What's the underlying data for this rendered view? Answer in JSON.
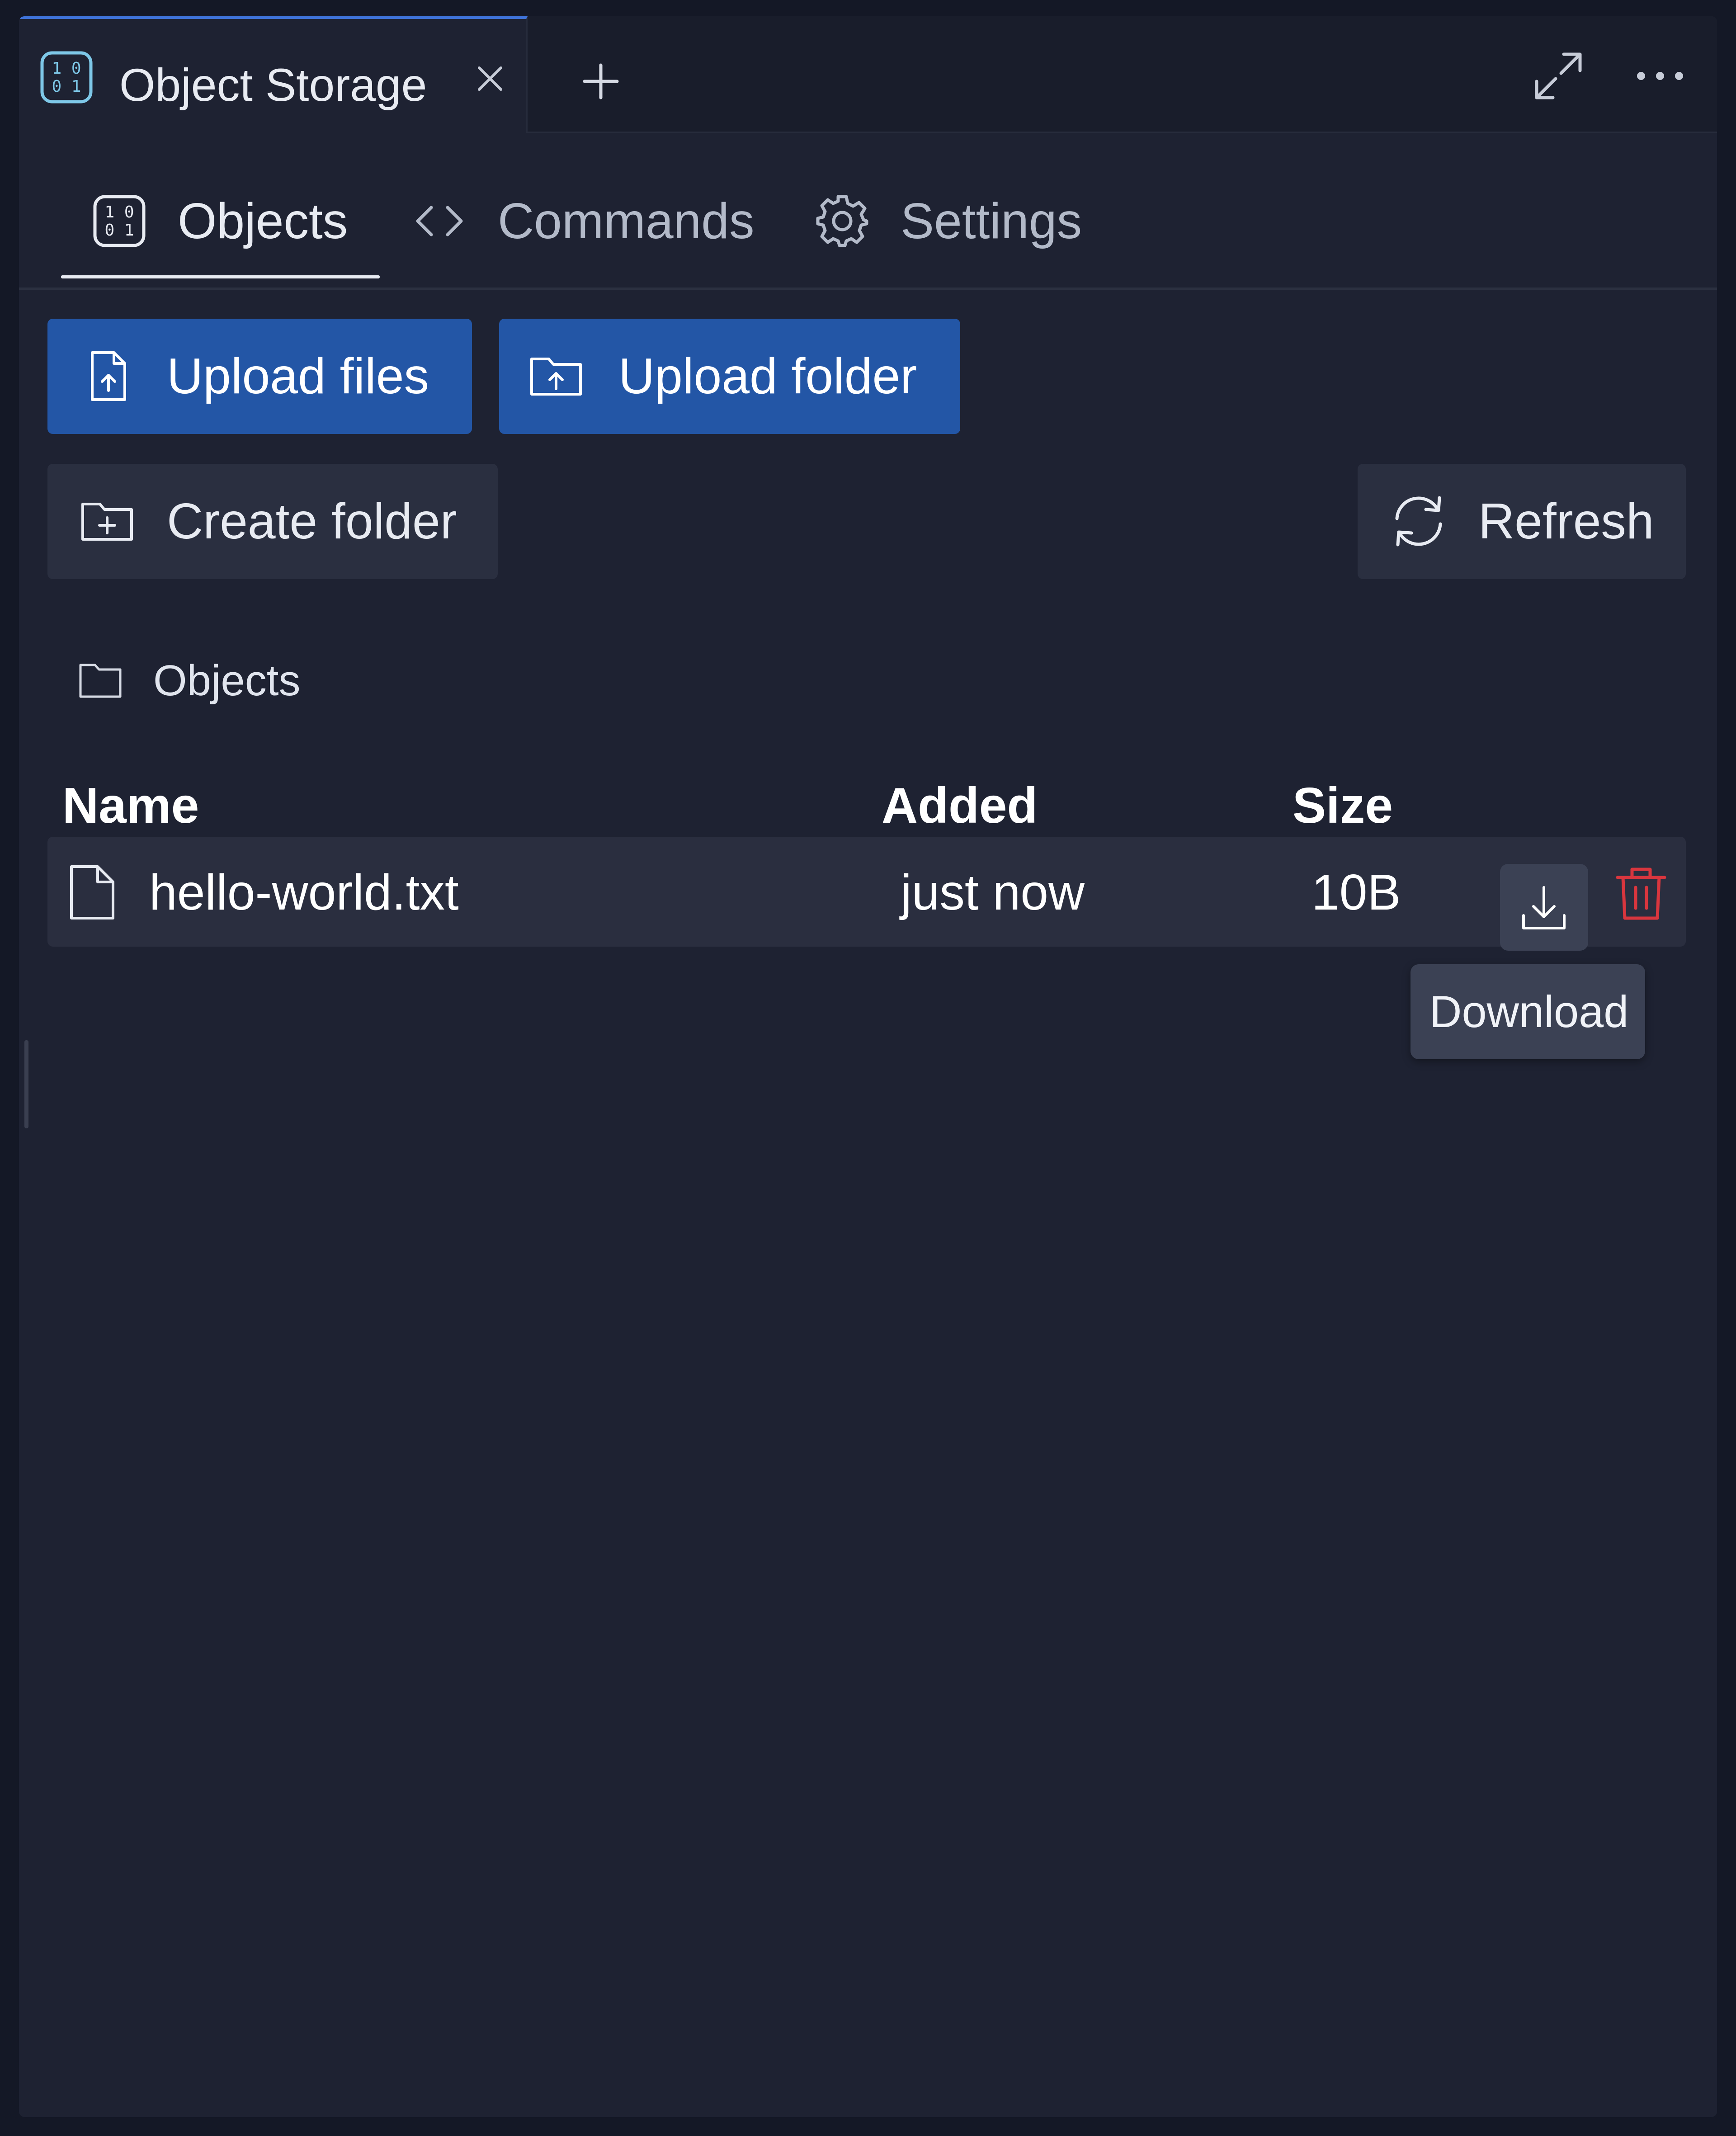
{
  "window": {
    "tab_title": "Object Storage"
  },
  "icons": {
    "app": "binary-data-icon",
    "close": "close-icon",
    "add": "plus-icon",
    "maximize": "maximize-icon",
    "more": "more-horizontal-icon",
    "commands": "code-icon",
    "settings": "gear-icon",
    "upload_files": "file-upload-icon",
    "upload_folder": "folder-upload-icon",
    "create_folder": "folder-add-icon",
    "refresh": "refresh-icon",
    "breadcrumb": "folder-icon",
    "file": "file-icon",
    "download": "download-icon",
    "delete": "trash-icon"
  },
  "colors": {
    "primary": "#2356a6",
    "accent": "#3f73d9",
    "danger": "#d9363e",
    "app_icon": "#7ec8e8"
  },
  "section_tabs": [
    {
      "label": "Objects",
      "active": true
    },
    {
      "label": "Commands",
      "active": false
    },
    {
      "label": "Settings",
      "active": false
    }
  ],
  "actions": {
    "upload_files": "Upload files",
    "upload_folder": "Upload folder",
    "create_folder": "Create folder",
    "refresh": "Refresh"
  },
  "breadcrumb": {
    "label": "Objects"
  },
  "table": {
    "columns": [
      "Name",
      "Added",
      "Size"
    ],
    "rows": [
      {
        "name": "hello-world.txt",
        "added": "just now",
        "size": "10B"
      }
    ]
  },
  "tooltip": {
    "text": "Download"
  }
}
